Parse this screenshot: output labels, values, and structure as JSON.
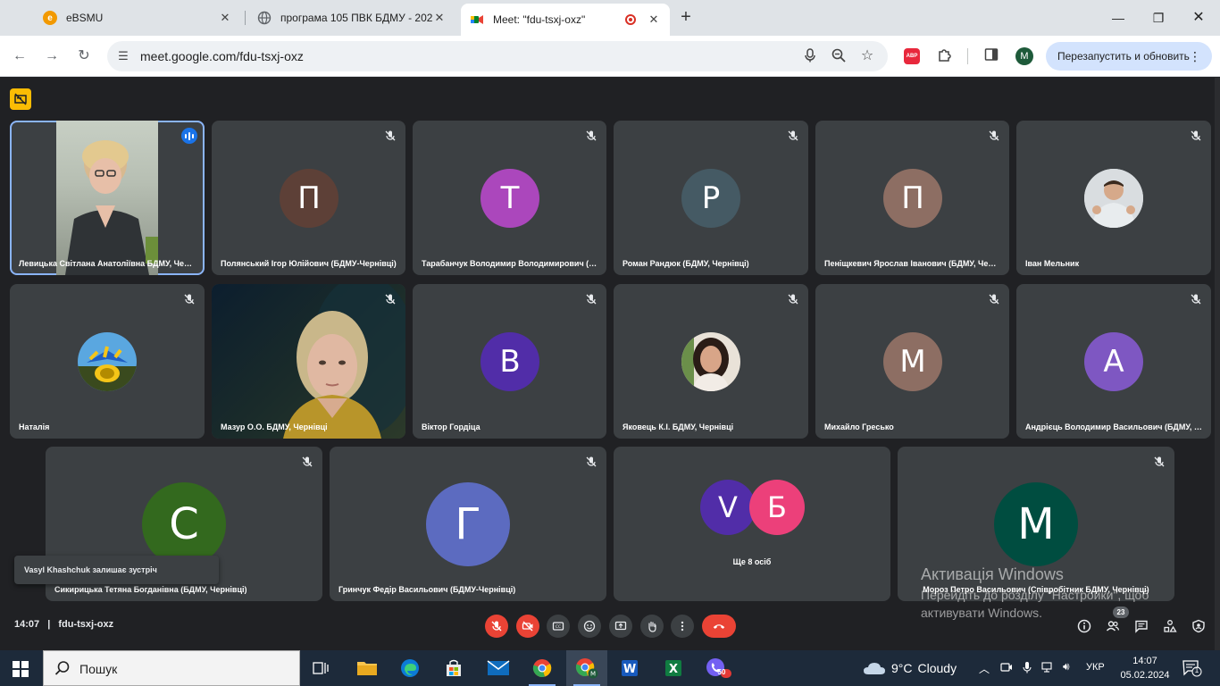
{
  "browser": {
    "tabs": [
      {
        "title": "eBSMU",
        "icon": "ebsmu-icon",
        "color": "#f29900"
      },
      {
        "title": "програма 105 ПВК БДМУ - 202",
        "icon": "globe-icon",
        "color": "#5f6368"
      },
      {
        "title": "Meet: \"fdu-tsxj-oxz\"",
        "icon": "meet-icon",
        "color": "#00832d"
      }
    ],
    "url": "meet.google.com/fdu-tsxj-oxz",
    "relaunch_label": "Перезапустить и обновить",
    "abp_label": "ABP",
    "profile_initial": "M"
  },
  "tiles": [
    {
      "name": "Левицька Світлана Анатоліївна БДМУ, Чернівці",
      "type": "video",
      "active": true
    },
    {
      "name": "Полянський Ігор Юлійович (БДМУ-Чернівці)",
      "initial": "П",
      "color": "#5d4037"
    },
    {
      "name": "Тарабанчук Володимир Володимирович (БДМУ, Чернівці)",
      "initial": "Т",
      "color": "#ab47bc"
    },
    {
      "name": "Роман Рандюк (БДМУ, Чернівці)",
      "initial": "Р",
      "color": "#455a64"
    },
    {
      "name": "Пеніщкевич Ярослав Іванович (БДМУ, Чернівці)",
      "initial": "П",
      "color": "#8d6e63"
    },
    {
      "name": "Іван Мельник",
      "type": "photo"
    },
    {
      "name": "Наталія",
      "type": "photo"
    },
    {
      "name": "Мазур О.О. БДМУ, Чернівці",
      "type": "video"
    },
    {
      "name": "Віктор Гордіца",
      "initial": "В",
      "color": "#512da8"
    },
    {
      "name": "Яковець К.І. БДМУ, Чернівці",
      "type": "photo"
    },
    {
      "name": "Михайло Гресько",
      "initial": "М",
      "color": "#8d6e63"
    },
    {
      "name": "Андрієць Володимир Васильович (БДМУ, Чернівці)",
      "initial": "А",
      "color": "#7e57c2"
    },
    {
      "name": "Сикирицька Тетяна Богданівна (БДМУ, Чернівці)",
      "initial": "С",
      "color": "#33691e"
    },
    {
      "name": "Гринчук Федір Васильович (БДМУ-Чернівці)",
      "initial": "Г",
      "color": "#5c6bc0"
    },
    {
      "name": "Ще 8 осіб",
      "initials": [
        "V",
        "Б"
      ],
      "colors": [
        "#512da8",
        "#ec407a"
      ]
    },
    {
      "name": "Мороз Петро Васильович (Співробітник БДМУ, Чернівці)",
      "initial": "М",
      "color": "#004d40"
    }
  ],
  "toast": "Vasyl Khashchuk залишає зустріч",
  "watermark": {
    "title": "Активація Windows",
    "line1": "Перейдіть до розділу \"Настройки\", щоб",
    "line2": "активувати Windows."
  },
  "meeting": {
    "time": "14:07",
    "separator": "|",
    "code": "fdu-tsxj-oxz",
    "participants_count": "23"
  },
  "taskbar": {
    "search_placeholder": "Пошук",
    "weather_temp": "9°C",
    "weather_desc": "Cloudy",
    "language": "УКР",
    "time": "14:07",
    "date": "05.02.2024",
    "viber_badge": "50",
    "notif_count": "1"
  }
}
